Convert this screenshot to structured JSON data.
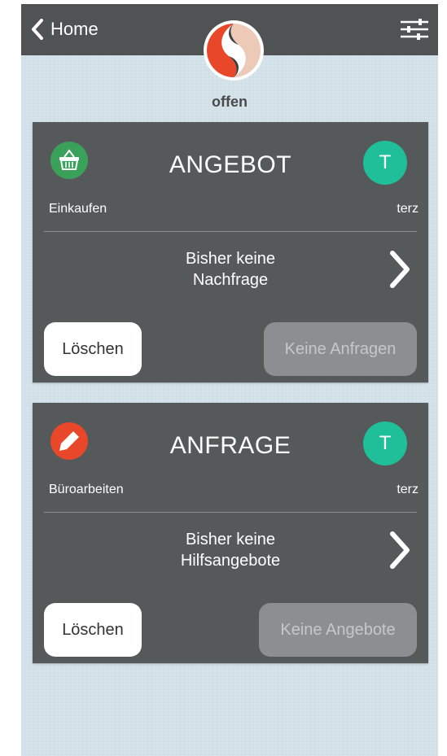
{
  "nav": {
    "back_label": "Home",
    "back_icon": "chevron-left-icon",
    "settings_icon": "sliders-icon",
    "logo_icon": "app-logo"
  },
  "status": "offen",
  "colors": {
    "navbar": "#4f5354",
    "background": "#d3e1e9",
    "card": "#55595a",
    "basket_icon_bg": "#3aa15a",
    "pencil_icon_bg": "#e8472a",
    "avatar_bg": "#1fbf9a",
    "disabled_button": "#8b8f91"
  },
  "cards": [
    {
      "title": "ANGEBOT",
      "category": "Einkaufen",
      "category_icon": "basket-icon",
      "user": "terz",
      "avatar_letter": "T",
      "message_line1": "Bisher keine",
      "message_line2": "Nachfrage",
      "delete_label": "Löschen",
      "status_button_label": "Keine Anfragen"
    },
    {
      "title": "ANFRAGE",
      "category": "Büroarbeiten",
      "category_icon": "pencil-icon",
      "user": "terz",
      "avatar_letter": "T",
      "message_line1": "Bisher keine",
      "message_line2": "Hilfsangebote",
      "delete_label": "Löschen",
      "status_button_label": "Keine Angebote"
    }
  ]
}
